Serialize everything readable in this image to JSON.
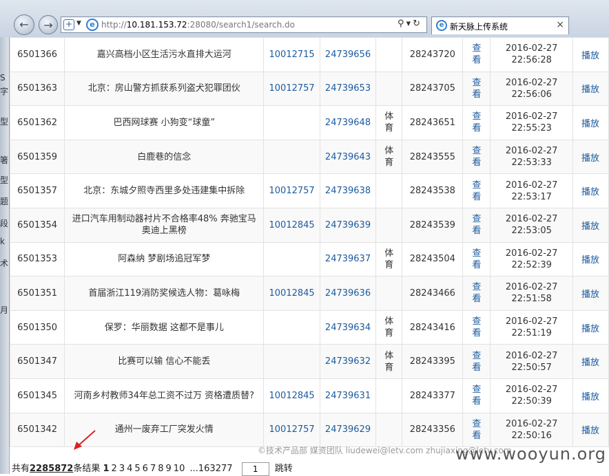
{
  "browser": {
    "url_prefix": "http://",
    "url_host": "10.181.153.72",
    "url_rest": ":28080/search1/search.do",
    "tab_title": "新天脉上传系统",
    "tab_close": "×",
    "back_icon": "arrow-left-icon",
    "forward_icon": "arrow-right-icon"
  },
  "left_strip_chars": [
    "S",
    "字",
    "型",
    "箸",
    "型",
    "题",
    "段",
    "k",
    "术",
    "月"
  ],
  "rows": [
    {
      "id": "6501366",
      "title": "嘉兴高档小区生活污水直排大运河",
      "a": "10012715",
      "b": "24739656",
      "cat": "",
      "c": "28243720",
      "view": "查看",
      "date": "2016-02-27",
      "time": "22:56:28",
      "play": "播放"
    },
    {
      "id": "6501363",
      "title": "北京：房山警方抓获系列盗犬犯罪团伙",
      "a": "10012757",
      "b": "24739653",
      "cat": "",
      "c": "28243705",
      "view": "查看",
      "date": "2016-02-27",
      "time": "22:56:06",
      "play": "播放"
    },
    {
      "id": "6501362",
      "title": "巴西网球赛 小狗变“球童”",
      "a": "",
      "b": "24739648",
      "cat": "体育",
      "c": "28243651",
      "view": "查看",
      "date": "2016-02-27",
      "time": "22:55:23",
      "play": "播放"
    },
    {
      "id": "6501359",
      "title": "白鹿巷的信念",
      "a": "",
      "b": "24739643",
      "cat": "体育",
      "c": "28243555",
      "view": "查看",
      "date": "2016-02-27",
      "time": "22:53:33",
      "play": "播放"
    },
    {
      "id": "6501357",
      "title": "北京：东城夕照寺西里多处违建集中拆除",
      "a": "10012757",
      "b": "24739638",
      "cat": "",
      "c": "28243538",
      "view": "查看",
      "date": "2016-02-27",
      "time": "22:53:17",
      "play": "播放"
    },
    {
      "id": "6501354",
      "title": "进口汽车用制动器衬片不合格率48% 奔驰宝马奥迪上黑榜",
      "a": "10012845",
      "b": "24739639",
      "cat": "",
      "c": "28243539",
      "view": "查看",
      "date": "2016-02-27",
      "time": "22:53:05",
      "play": "播放"
    },
    {
      "id": "6501353",
      "title": "阿森纳 梦剧场追冠军梦",
      "a": "",
      "b": "24739637",
      "cat": "体育",
      "c": "28243504",
      "view": "查看",
      "date": "2016-02-27",
      "time": "22:52:39",
      "play": "播放"
    },
    {
      "id": "6501351",
      "title": "首届浙江119消防奖候选人物：葛咏梅",
      "a": "10012845",
      "b": "24739636",
      "cat": "",
      "c": "28243466",
      "view": "查看",
      "date": "2016-02-27",
      "time": "22:51:58",
      "play": "播放"
    },
    {
      "id": "6501350",
      "title": "保罗：华丽数据 这都不是事儿",
      "a": "",
      "b": "24739634",
      "cat": "体育",
      "c": "28243416",
      "view": "查看",
      "date": "2016-02-27",
      "time": "22:51:19",
      "play": "播放"
    },
    {
      "id": "6501347",
      "title": "比赛可以输 信心不能丢",
      "a": "",
      "b": "24739632",
      "cat": "体育",
      "c": "28243395",
      "view": "查看",
      "date": "2016-02-27",
      "time": "22:50:57",
      "play": "播放"
    },
    {
      "id": "6501345",
      "title": "河南乡村教师34年总工资不过万 资格遭质替?",
      "a": "10012845",
      "b": "24739631",
      "cat": "",
      "c": "28243377",
      "view": "查看",
      "date": "2016-02-27",
      "time": "22:50:39",
      "play": "播放"
    },
    {
      "id": "6501342",
      "title": "通州一废弃工厂突发火情",
      "a": "10012757",
      "b": "24739629",
      "cat": "",
      "c": "28243356",
      "view": "查看",
      "date": "2016-02-27",
      "time": "22:50:16",
      "play": "播放"
    }
  ],
  "footer": {
    "credit": "©技术产品部 媒资团队 liudewei@letv.com zhujiaxing@letv.com",
    "total_prefix": "共有",
    "total": "2285872",
    "total_suffix": "条结果",
    "pages": [
      "1",
      "2",
      "3",
      "4",
      "5",
      "6",
      "7",
      "8",
      "9",
      "10"
    ],
    "ellipsis_last": "...163277",
    "jump_value": "1",
    "jump_label": "跳转",
    "watermark": "www.wooyun.org"
  }
}
